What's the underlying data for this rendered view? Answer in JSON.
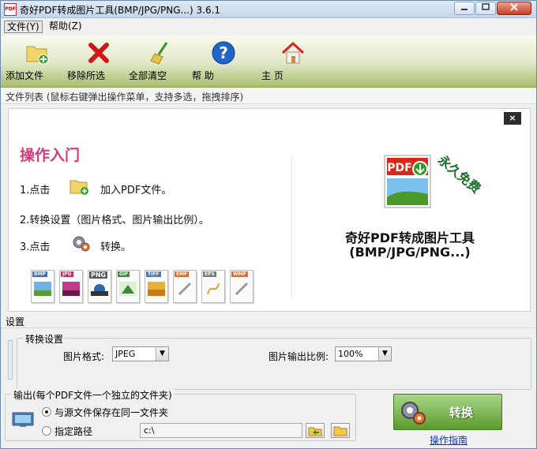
{
  "window": {
    "title": "奇好PDF转成图片工具(BMP/JPG/PNG...) 3.6.1",
    "app_icon_text": "PDF"
  },
  "menu": [
    {
      "label": "文件(Y)"
    },
    {
      "label": "帮助(Z)"
    }
  ],
  "toolbar": [
    {
      "label": "添加文件",
      "icon": "add-folder-icon"
    },
    {
      "label": "移除所选",
      "icon": "red-x-icon"
    },
    {
      "label": "全部清空",
      "icon": "broom-icon"
    },
    {
      "label": "帮 助",
      "icon": "help-icon"
    },
    {
      "label": "主 页",
      "icon": "home-icon"
    }
  ],
  "filelist": {
    "header": "文件列表  (鼠标右键弹出操作菜单，支持多选，拖拽排序)"
  },
  "guide": {
    "close": "×",
    "title": "操作入门",
    "step1_pre": "1.点击",
    "step1_post": "加入PDF文件。",
    "step2": "2.转换设置（图片格式、图片输出比例）。",
    "step3_pre": "3.点击",
    "step3_post": "转换。",
    "formats": [
      "BMP",
      "JPG",
      "PNG",
      "GIF",
      "TIFF",
      "EMF",
      "EPS",
      "WMF"
    ],
    "stamp": "永久免费",
    "big_icon_text": "PDF",
    "app_name_line1": "奇好PDF转成图片工具",
    "app_name_line2": "(BMP/JPG/PNG...)"
  },
  "settings": {
    "bar_label": "设置",
    "group_title": "转换设置",
    "format_label": "图片格式:",
    "format_value": "JPEG",
    "ratio_label": "图片输出比例:",
    "ratio_value": "100%"
  },
  "output": {
    "group_title": "输出(每个PDF文件一个独立的文件夹)",
    "option_same": "与源文件保存在同一文件夹",
    "option_path": "指定路径",
    "path_value": "c:\\",
    "selected": "same"
  },
  "convert": {
    "label": "转换",
    "guide_link": "操作指南"
  },
  "colors": {
    "toolbar_green": "#a9bd6e",
    "guide_title": "#d23c7a",
    "convert_green": "#5b9a2c",
    "link": "#1838b8"
  }
}
